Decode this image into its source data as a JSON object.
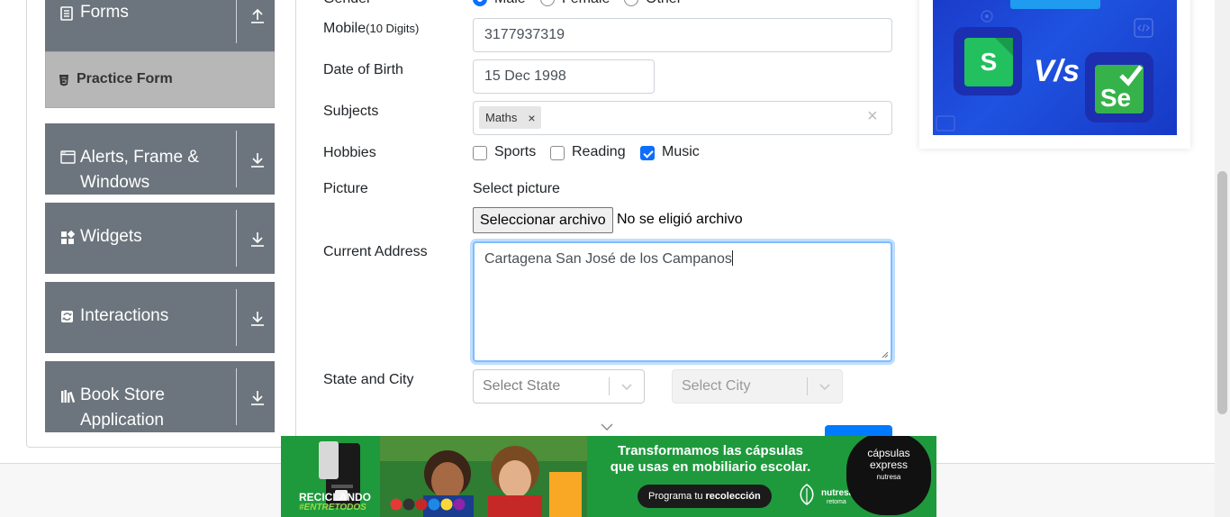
{
  "sidebar": {
    "forms_label": "Forms",
    "active_item": "Practice Form",
    "groups": [
      {
        "label": "Alerts, Frame & Windows",
        "icon": "window-icon"
      },
      {
        "label": "Widgets",
        "icon": "widgets-icon"
      },
      {
        "label": "Interactions",
        "icon": "interactions-icon"
      },
      {
        "label": "Book Store Application",
        "icon": "books-icon"
      }
    ]
  },
  "form": {
    "gender_label": "Gender",
    "gender_options": [
      "Male",
      "Female",
      "Other"
    ],
    "gender_selected": "Male",
    "mobile_label": "Mobile",
    "mobile_hint": "(10 Digits)",
    "mobile_value": "3177937319",
    "dob_label": "Date of Birth",
    "dob_value": "15 Dec 1998",
    "subjects_label": "Subjects",
    "subjects": [
      "Maths"
    ],
    "subject_remove": "×",
    "subjects_clear": "×",
    "hobbies_label": "Hobbies",
    "hobbies": [
      {
        "label": "Sports",
        "checked": false
      },
      {
        "label": "Reading",
        "checked": false
      },
      {
        "label": "Music",
        "checked": true
      }
    ],
    "picture_label": "Picture",
    "picture_prompt": "Select picture",
    "file_button": "Seleccionar archivo",
    "file_status": "No se eligió archivo",
    "address_label": "Current Address",
    "address_value": "Cartagena San José de los Campanos",
    "state_city_label": "State and City",
    "state_placeholder": "Select State",
    "city_placeholder": "Select City"
  },
  "bottom_ad": {
    "headline_1": "Transformamos las cápsulas",
    "headline_2": "que usas en ",
    "headline_2_bold": "mobiliario escolar.",
    "cta": "Programa tu",
    "cta_bold": "recolección",
    "recycle_1": "RECICLANDO",
    "recycle_2": "#ENTRETODOS",
    "brand": "nutresa",
    "brand_sub": "retoma",
    "badge_1": "cápsulas",
    "badge_2": "express",
    "badge_3": "nutresa"
  },
  "colors": {
    "sidebar_group": "#6c757d",
    "sidebar_active": "#b7b7b7",
    "accent": "#0d6efd",
    "ad_green": "#1e9a3c",
    "right_ad_blue": "#1f52e0"
  }
}
